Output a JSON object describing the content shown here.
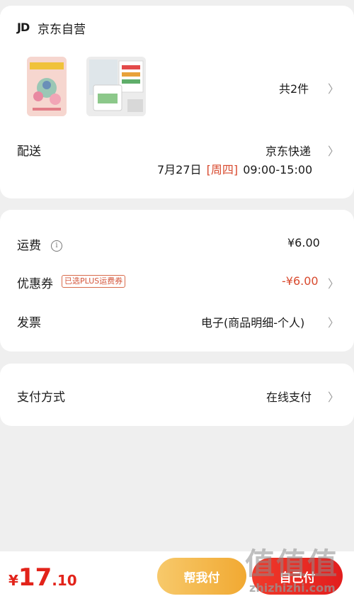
{
  "store": {
    "logo": "JD",
    "name": "京东自营",
    "item_count": "共2件"
  },
  "delivery": {
    "label": "配送",
    "carrier": "京东快递",
    "date": "7月27日",
    "weekday": "[周四]",
    "time": "09:00-15:00"
  },
  "fees": {
    "shipping_label": "运费",
    "shipping_value": "¥6.00",
    "coupon_label": "优惠券",
    "coupon_tag": "已选PLUS运费券",
    "coupon_value": "-¥6.00",
    "invoice_label": "发票",
    "invoice_value": "电子(商品明细-个人)"
  },
  "payment": {
    "label": "支付方式",
    "value": "在线支付"
  },
  "footer": {
    "currency": "¥",
    "total_int": "17",
    "total_dec": ".10",
    "help_pay": "帮我付",
    "self_pay": "自己付"
  },
  "watermark": {
    "glyphs": "值值值",
    "site": "zhizhizhi.com"
  },
  "colors": {
    "accent_red": "#e2231a",
    "coupon_red": "#d84a2e",
    "help_pay_gold": "#f1a932"
  }
}
